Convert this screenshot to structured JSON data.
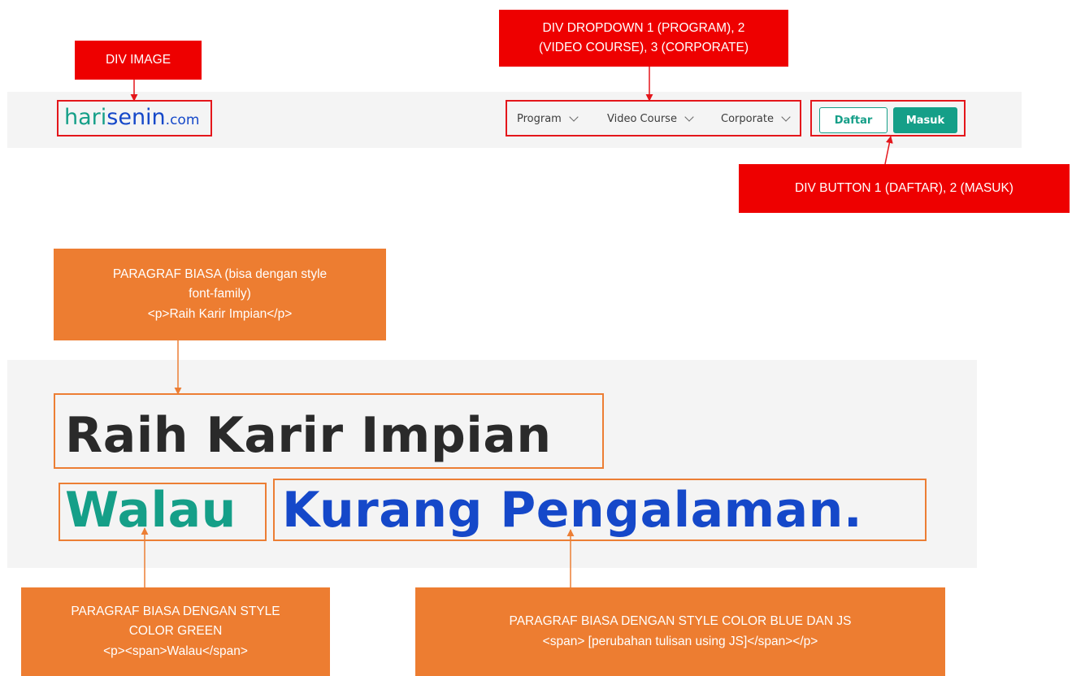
{
  "navbar": {
    "logo": {
      "part1": "hari",
      "part2": "senin",
      "part3": ".com"
    },
    "dropdowns": [
      {
        "label": "Program"
      },
      {
        "label": "Video Course"
      },
      {
        "label": "Corporate"
      }
    ],
    "buttons": {
      "daftar": "Daftar",
      "masuk": "Masuk"
    }
  },
  "hero": {
    "line1": "Raih Karir Impian",
    "line2_green": "Walau",
    "line2_blue": "Kurang Pengalaman."
  },
  "annotations": {
    "div_image": "DIV IMAGE",
    "div_dropdown_line1": "DIV DROPDOWN 1 (PROGRAM), 2",
    "div_dropdown_line2": "(VIDEO COURSE), 3 (CORPORATE)",
    "div_button": "DIV BUTTON 1 (DAFTAR), 2 (MASUK)",
    "para_biasa_line1": "PARAGRAF BIASA (bisa dengan style",
    "para_biasa_line2": "font-family)",
    "para_biasa_line3": "<p>Raih Karir Impian</p>",
    "para_green_line1": "PARAGRAF BIASA DENGAN STYLE",
    "para_green_line2": "COLOR GREEN",
    "para_green_line3": "<p><span>Walau</span>",
    "para_blue_line1": "PARAGRAF BIASA DENGAN STYLE COLOR BLUE DAN JS",
    "para_blue_line2": "<span> [perubahan tulisan using JS]</span></p>"
  },
  "colors": {
    "brand_green": "#159f88",
    "brand_blue": "#1548c9",
    "annotation_red": "#ee0000",
    "annotation_orange": "#ed7d31"
  }
}
